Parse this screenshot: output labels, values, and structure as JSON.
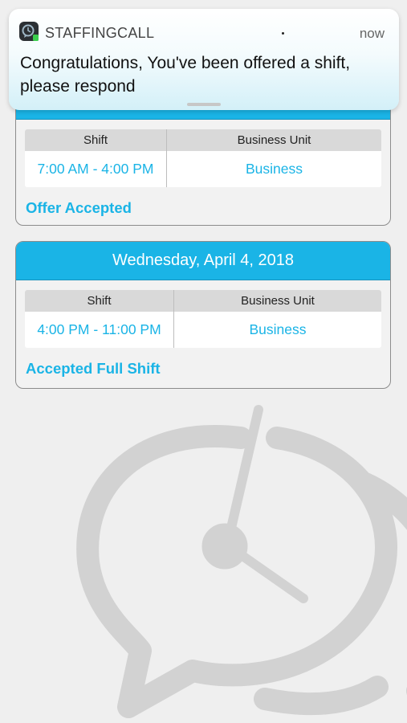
{
  "notification": {
    "app_name": "STAFFINGCALL",
    "time": "now",
    "message": "Congratulations, You've been offered a shift, please respond",
    "icon": "staffingcall-app-icon"
  },
  "shifts": [
    {
      "date": "",
      "table_headers": {
        "shift": "Shift",
        "business_unit": "Business Unit"
      },
      "time_range": "7:00 AM - 4:00 PM",
      "business_unit": "Business",
      "status": "Offer Accepted"
    },
    {
      "date": "Wednesday, April 4, 2018",
      "table_headers": {
        "shift": "Shift",
        "business_unit": "Business Unit"
      },
      "time_range": "4:00 PM - 11:00 PM",
      "business_unit": "Business",
      "status": "Accepted Full Shift"
    }
  ],
  "background": {
    "icon": "clock-chat-watermark-icon"
  },
  "colors": {
    "accent": "#1ab4e6",
    "card_border": "#8c8c8c",
    "background": "#efefef"
  }
}
